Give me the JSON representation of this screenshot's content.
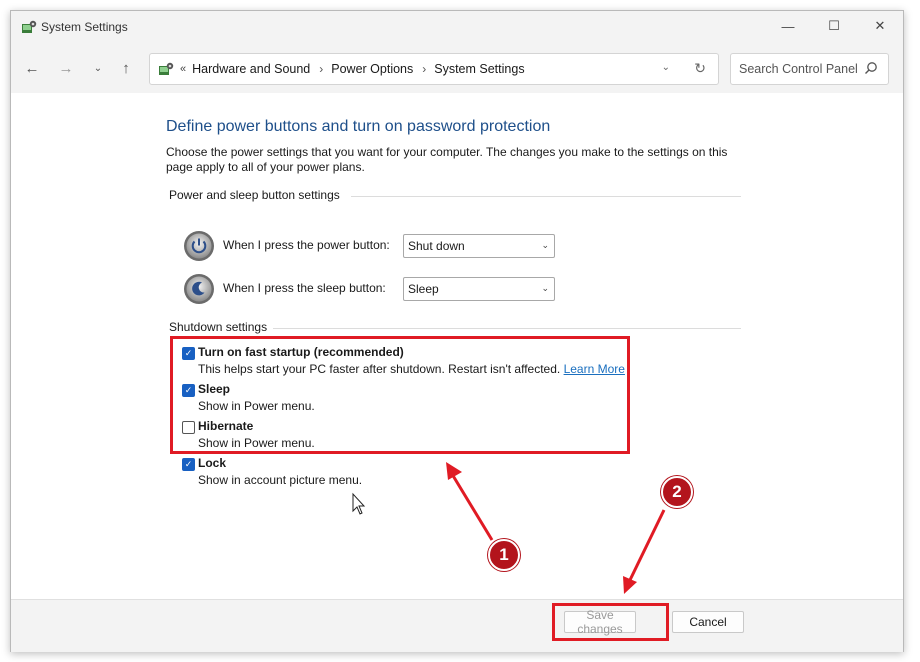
{
  "window": {
    "title": "System Settings"
  },
  "window_controls": {
    "minimize": "—",
    "maximize": "☐",
    "close": "✕"
  },
  "nav": {
    "back": "←",
    "forward": "→",
    "recent": "⌄",
    "up": "↑"
  },
  "address_bar": {
    "chevron": "«",
    "breadcrumbs": [
      "Hardware and Sound",
      "Power Options",
      "System Settings"
    ],
    "separator": "›",
    "dropdown": "⌄",
    "refresh": "↻"
  },
  "search": {
    "placeholder": "Search Control Panel"
  },
  "page": {
    "heading": "Define power buttons and turn on password protection",
    "description": "Choose the power settings that you want for your computer. The changes you make to the settings on this page apply to all of your power plans."
  },
  "power_section": {
    "title": "Power and sleep button settings",
    "rows": [
      {
        "label": "When I press the power button:",
        "value": "Shut down",
        "icon": "power-button-icon"
      },
      {
        "label": "When I press the sleep button:",
        "value": "Sleep",
        "icon": "sleep-button-icon"
      }
    ]
  },
  "shutdown_section": {
    "title": "Shutdown settings",
    "options": [
      {
        "title": "Turn on fast startup (recommended)",
        "subtitle": "This helps start your PC faster after shutdown. Restart isn't affected.",
        "link": "Learn More",
        "checked": true
      },
      {
        "title": "Sleep",
        "subtitle": "Show in Power menu.",
        "checked": true
      },
      {
        "title": "Hibernate",
        "subtitle": "Show in Power menu.",
        "checked": false
      },
      {
        "title": "Lock",
        "subtitle": "Show in account picture menu.",
        "checked": true
      }
    ]
  },
  "checkmark": "✓",
  "footer": {
    "save": "Save changes",
    "cancel": "Cancel"
  },
  "annotations": {
    "marker_1": "1",
    "marker_2": "2",
    "color": "#e01b24",
    "marker_color": "#b3141c"
  }
}
